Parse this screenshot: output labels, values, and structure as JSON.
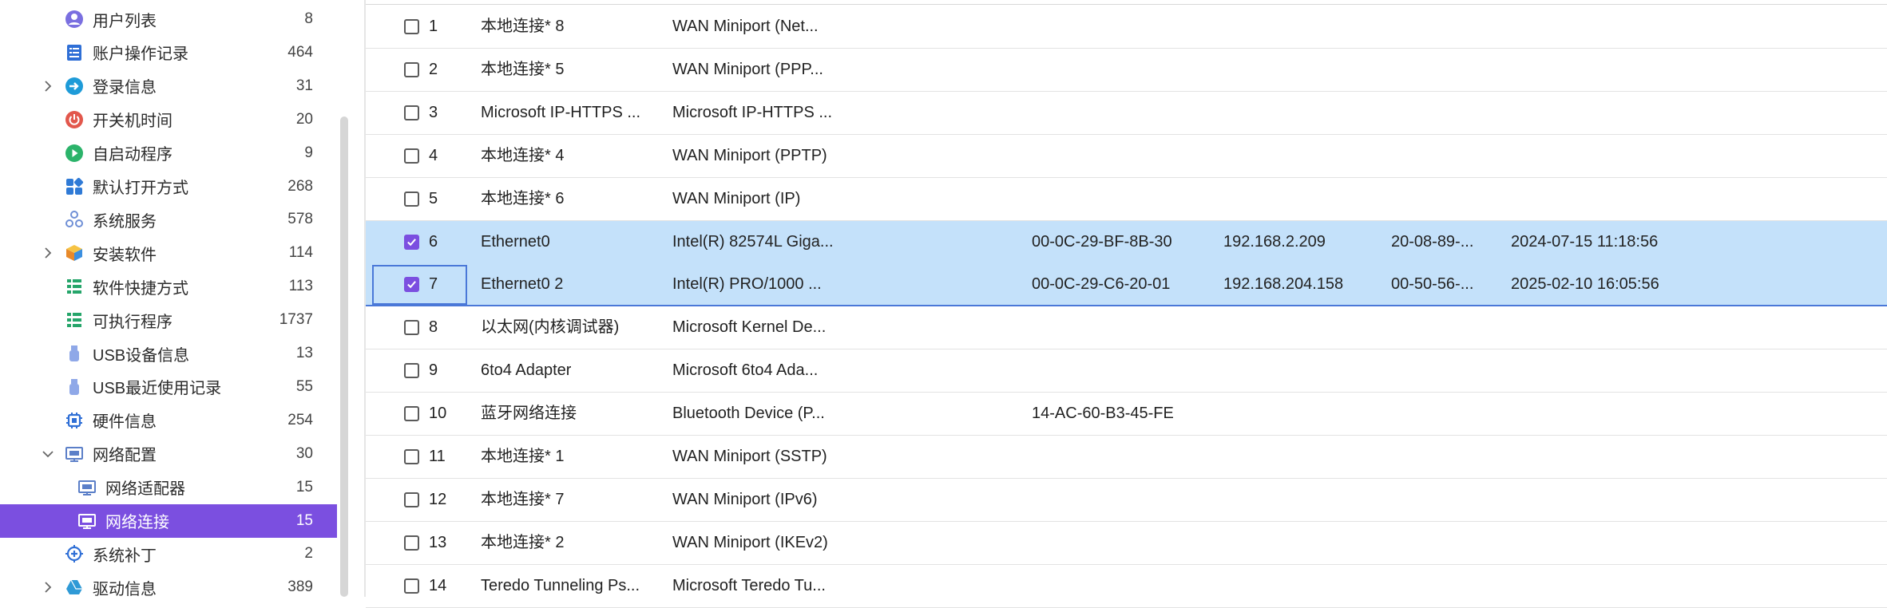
{
  "sidebar": {
    "items": [
      {
        "label": "用户列表",
        "count": "8",
        "icon": "user-icon",
        "color": "#7a6fe0",
        "expand": "none",
        "level": 0,
        "selected": false
      },
      {
        "label": "账户操作记录",
        "count": "464",
        "icon": "account-log-icon",
        "color": "#2f6fd6",
        "expand": "none",
        "level": 0,
        "selected": false
      },
      {
        "label": "登录信息",
        "count": "31",
        "icon": "login-icon",
        "color": "#1e9bd8",
        "expand": "collapsed",
        "level": 0,
        "selected": false
      },
      {
        "label": "开关机时间",
        "count": "20",
        "icon": "power-icon",
        "color": "#e2574c",
        "expand": "none",
        "level": 0,
        "selected": false
      },
      {
        "label": "自启动程序",
        "count": "9",
        "icon": "play-icon",
        "color": "#2bb36a",
        "expand": "none",
        "level": 0,
        "selected": false
      },
      {
        "label": "默认打开方式",
        "count": "268",
        "icon": "apps-icon",
        "color": "#2f7ad6",
        "expand": "none",
        "level": 0,
        "selected": false
      },
      {
        "label": "系统服务",
        "count": "578",
        "icon": "services-icon",
        "color": "#6f8fd6",
        "expand": "none",
        "level": 0,
        "selected": false
      },
      {
        "label": "安装软件",
        "count": "114",
        "icon": "package-icon",
        "color": "#f0a020",
        "expand": "collapsed",
        "level": 0,
        "selected": false
      },
      {
        "label": "软件快捷方式",
        "count": "113",
        "icon": "shortcut-list-icon",
        "color": "#25a56a",
        "expand": "none",
        "level": 0,
        "selected": false
      },
      {
        "label": "可执行程序",
        "count": "1737",
        "icon": "executable-list-icon",
        "color": "#25a56a",
        "expand": "none",
        "level": 0,
        "selected": false
      },
      {
        "label": "USB设备信息",
        "count": "13",
        "icon": "usb-icon",
        "color": "#8fa8e8",
        "expand": "none",
        "level": 0,
        "selected": false
      },
      {
        "label": "USB最近使用记录",
        "count": "55",
        "icon": "usb-history-icon",
        "color": "#8fa8e8",
        "expand": "none",
        "level": 0,
        "selected": false
      },
      {
        "label": "硬件信息",
        "count": "254",
        "icon": "chip-icon",
        "color": "#2f6fd6",
        "expand": "none",
        "level": 0,
        "selected": false
      },
      {
        "label": "网络配置",
        "count": "30",
        "icon": "network-config-icon",
        "color": "#5b7fc8",
        "expand": "expanded",
        "level": 0,
        "selected": false
      },
      {
        "label": "网络适配器",
        "count": "15",
        "icon": "network-adapter-icon",
        "color": "#5b7fc8",
        "expand": "none",
        "level": 1,
        "selected": false
      },
      {
        "label": "网络连接",
        "count": "15",
        "icon": "network-connection-icon",
        "color": "#ffffff",
        "expand": "none",
        "level": 1,
        "selected": true
      },
      {
        "label": "系统补丁",
        "count": "2",
        "icon": "patch-icon",
        "color": "#2f6fd6",
        "expand": "none",
        "level": 0,
        "selected": false
      },
      {
        "label": "驱动信息",
        "count": "389",
        "icon": "driver-icon",
        "color": "#2f9ad6",
        "expand": "collapsed",
        "level": 0,
        "selected": false
      }
    ]
  },
  "table": {
    "rows": [
      {
        "index": "1",
        "name": "本地连接* 8",
        "device": "WAN Miniport (Net...",
        "mac": "",
        "ip": "",
        "gateway": "",
        "time": "",
        "checked": false
      },
      {
        "index": "2",
        "name": "本地连接* 5",
        "device": "WAN Miniport (PPP...",
        "mac": "",
        "ip": "",
        "gateway": "",
        "time": "",
        "checked": false
      },
      {
        "index": "3",
        "name": "Microsoft IP-HTTPS ...",
        "device": "Microsoft IP-HTTPS ...",
        "mac": "",
        "ip": "",
        "gateway": "",
        "time": "",
        "checked": false
      },
      {
        "index": "4",
        "name": "本地连接* 4",
        "device": "WAN Miniport (PPTP)",
        "mac": "",
        "ip": "",
        "gateway": "",
        "time": "",
        "checked": false
      },
      {
        "index": "5",
        "name": "本地连接* 6",
        "device": "WAN Miniport (IP)",
        "mac": "",
        "ip": "",
        "gateway": "",
        "time": "",
        "checked": false
      },
      {
        "index": "6",
        "name": "Ethernet0",
        "device": "Intel(R) 82574L Giga...",
        "mac": "00-0C-29-BF-8B-30",
        "ip": "192.168.2.209",
        "gateway": "20-08-89-...",
        "time": "2024-07-15 11:18:56",
        "checked": true
      },
      {
        "index": "7",
        "name": "Ethernet0 2",
        "device": "Intel(R) PRO/1000 ...",
        "mac": "00-0C-29-C6-20-01",
        "ip": "192.168.204.158",
        "gateway": "00-50-56-...",
        "time": "2025-02-10 16:05:56",
        "checked": true
      },
      {
        "index": "8",
        "name": "以太网(内核调试器)",
        "device": "Microsoft Kernel De...",
        "mac": "",
        "ip": "",
        "gateway": "",
        "time": "",
        "checked": false
      },
      {
        "index": "9",
        "name": "6to4 Adapter",
        "device": "Microsoft 6to4 Ada...",
        "mac": "",
        "ip": "",
        "gateway": "",
        "time": "",
        "checked": false
      },
      {
        "index": "10",
        "name": "蓝牙网络连接",
        "device": "Bluetooth Device (P...",
        "mac": "14-AC-60-B3-45-FE",
        "ip": "",
        "gateway": "",
        "time": "",
        "checked": false
      },
      {
        "index": "11",
        "name": "本地连接* 1",
        "device": "WAN Miniport (SSTP)",
        "mac": "",
        "ip": "",
        "gateway": "",
        "time": "",
        "checked": false
      },
      {
        "index": "12",
        "name": "本地连接* 7",
        "device": "WAN Miniport (IPv6)",
        "mac": "",
        "ip": "",
        "gateway": "",
        "time": "",
        "checked": false
      },
      {
        "index": "13",
        "name": "本地连接* 2",
        "device": "WAN Miniport (IKEv2)",
        "mac": "",
        "ip": "",
        "gateway": "",
        "time": "",
        "checked": false
      },
      {
        "index": "14",
        "name": "Teredo Tunneling Ps...",
        "device": "Microsoft Teredo Tu...",
        "mac": "",
        "ip": "",
        "gateway": "",
        "time": "",
        "checked": false
      }
    ]
  },
  "colors": {
    "accent": "#7b4fe0",
    "row_selected": "#c4e1fa",
    "focus_border": "#4a78d8"
  }
}
